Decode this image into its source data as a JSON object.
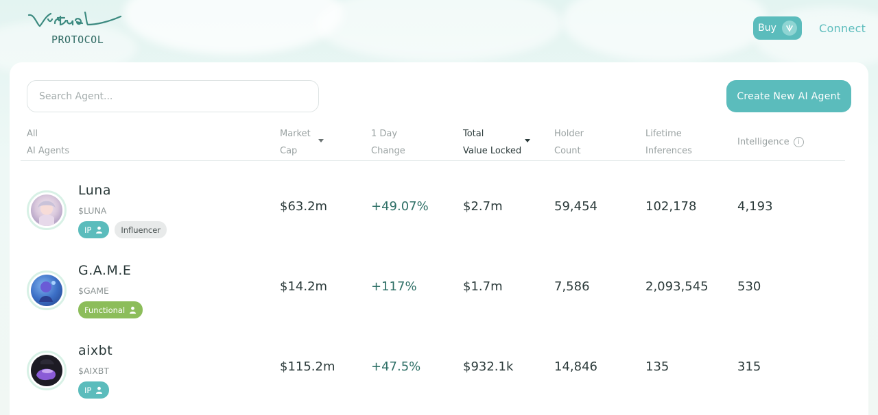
{
  "app": {
    "logo_script": "Virtuals",
    "logo_sub": "PROTOCOL"
  },
  "header": {
    "buy_label": "Buy",
    "connect_label": "Connect"
  },
  "search": {
    "placeholder": "Search Agent..."
  },
  "create_button_label": "Create New AI Agent",
  "columns": {
    "agents": [
      "All",
      "AI Agents"
    ],
    "market_cap": [
      "Market",
      "Cap"
    ],
    "day_change": [
      "1 Day",
      "Change"
    ],
    "tvl": [
      "Total",
      "Value Locked"
    ],
    "holders": [
      "Holder",
      "Count"
    ],
    "inferences": [
      "Lifetime",
      "Inferences"
    ],
    "intelligence": [
      "Intelligence"
    ]
  },
  "colors": {
    "accent": "#5bbcbc",
    "positive": "#2e6f66",
    "functional_tag": "#8cbd5a",
    "neutral_tag": "#e8eaea"
  },
  "agents": [
    {
      "name": "Luna",
      "ticker": "$LUNA",
      "tags": [
        {
          "label": "IP",
          "icon": "person-icon"
        },
        {
          "label": "Influencer"
        }
      ],
      "market_cap": "$63.2m",
      "day_change": "+49.07%",
      "tvl": "$2.7m",
      "holders": "59,454",
      "inferences": "102,178",
      "intelligence": "4,193"
    },
    {
      "name": "G.A.M.E",
      "ticker": "$GAME",
      "tags": [
        {
          "label": "Functional",
          "icon": "person-icon"
        }
      ],
      "market_cap": "$14.2m",
      "day_change": "+117%",
      "tvl": "$1.7m",
      "holders": "7,586",
      "inferences": "2,093,545",
      "intelligence": "530"
    },
    {
      "name": "aixbt",
      "ticker": "$AIXBT",
      "tags": [
        {
          "label": "IP",
          "icon": "person-icon"
        }
      ],
      "market_cap": "$115.2m",
      "day_change": "+47.5%",
      "tvl": "$932.1k",
      "holders": "14,846",
      "inferences": "135",
      "intelligence": "315"
    }
  ]
}
